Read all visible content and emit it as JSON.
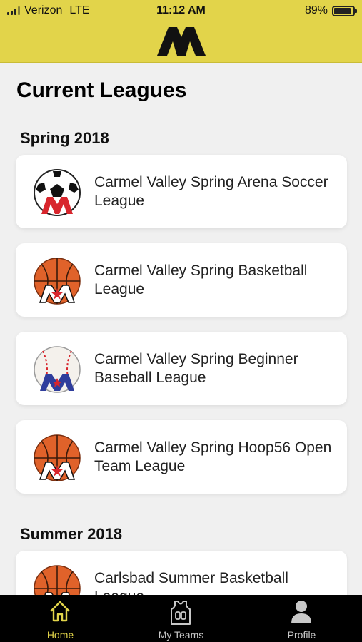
{
  "status": {
    "carrier": "Verizon",
    "network": "LTE",
    "time": "11:12 AM",
    "battery": "89%",
    "battery_level": 0.89
  },
  "colors": {
    "brand_yellow": "#e2d44a",
    "tabbar": "#000000",
    "active_tab": "#e2d44a"
  },
  "header": {
    "logo_icon": "league-logo-icon"
  },
  "page": {
    "title": "Current Leagues"
  },
  "sections": [
    {
      "title": "Spring  2018",
      "leagues": [
        {
          "name": "Carmel Valley Spring Arena Soccer League",
          "icon": "soccer-ball-icon"
        },
        {
          "name": "Carmel Valley Spring Basketball League",
          "icon": "basketball-icon"
        },
        {
          "name": "Carmel Valley Spring Beginner Baseball League",
          "icon": "baseball-icon"
        },
        {
          "name": "Carmel Valley Spring Hoop56 Open Team League",
          "icon": "basketball-icon"
        }
      ]
    },
    {
      "title": "Summer 2018",
      "leagues": [
        {
          "name": "Carlsbad Summer Basketball League",
          "icon": "basketball-icon"
        }
      ]
    }
  ],
  "tabbar": {
    "tabs": [
      {
        "label": "Home",
        "icon": "home-icon",
        "active": true
      },
      {
        "label": "My Teams",
        "icon": "jersey-icon",
        "active": false
      },
      {
        "label": "Profile",
        "icon": "person-icon",
        "active": false
      }
    ]
  }
}
